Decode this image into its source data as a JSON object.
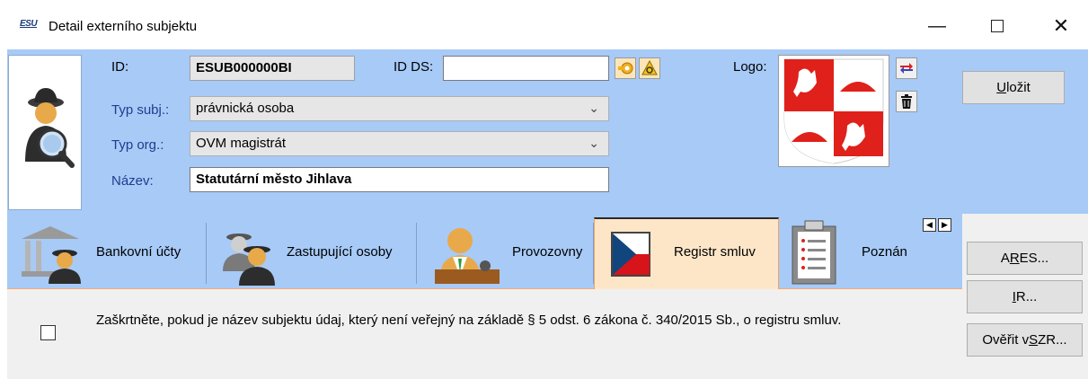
{
  "window": {
    "app_icon_text": "ESU",
    "title": "Detail externího subjektu",
    "minimize": "—",
    "close": "✕"
  },
  "form": {
    "id_label": "ID:",
    "id_value": "ESUB000000BI",
    "idds_label": "ID DS:",
    "idds_value": "",
    "typ_subj_label": "Typ subj.:",
    "typ_subj_value": "právnická osoba",
    "typ_org_label": "Typ org.:",
    "typ_org_value": "OVM magistrát",
    "nazev_label": "Název:",
    "nazev_value": "Statutární město Jihlava",
    "logo_label": "Logo:"
  },
  "buttons": {
    "save_pre": "",
    "save_u": "U",
    "save_post": "ložit",
    "ares_pre": "A",
    "ares_u": "R",
    "ares_post": "ES...",
    "ir_pre": "",
    "ir_u": "I",
    "ir_post": "R...",
    "overit_pre": "Ověřit v ",
    "overit_u": "S",
    "overit_post": "ZR..."
  },
  "tabs": [
    {
      "label": "Bankovní účty",
      "icon": "bank-icon"
    },
    {
      "label": "Zastupující osoby",
      "icon": "persons-icon"
    },
    {
      "label": "Provozovny",
      "icon": "office-icon"
    },
    {
      "label": "Registr smluv",
      "icon": "flag-icon",
      "active": true
    },
    {
      "label": "Poznán",
      "icon": "clipboard-icon"
    }
  ],
  "content": {
    "checkbox_checked": false,
    "notice_text": "Zaškrtněte, pokud je název subjektu údaj, který není veřejný na základě § 5 odst. 6 zákona č. 340/2015 Sb., o registru smluv."
  },
  "colors": {
    "header_bg": "#a7caf7",
    "active_tab_bg": "#fde6c8",
    "content_bg": "#f0f0f0"
  }
}
